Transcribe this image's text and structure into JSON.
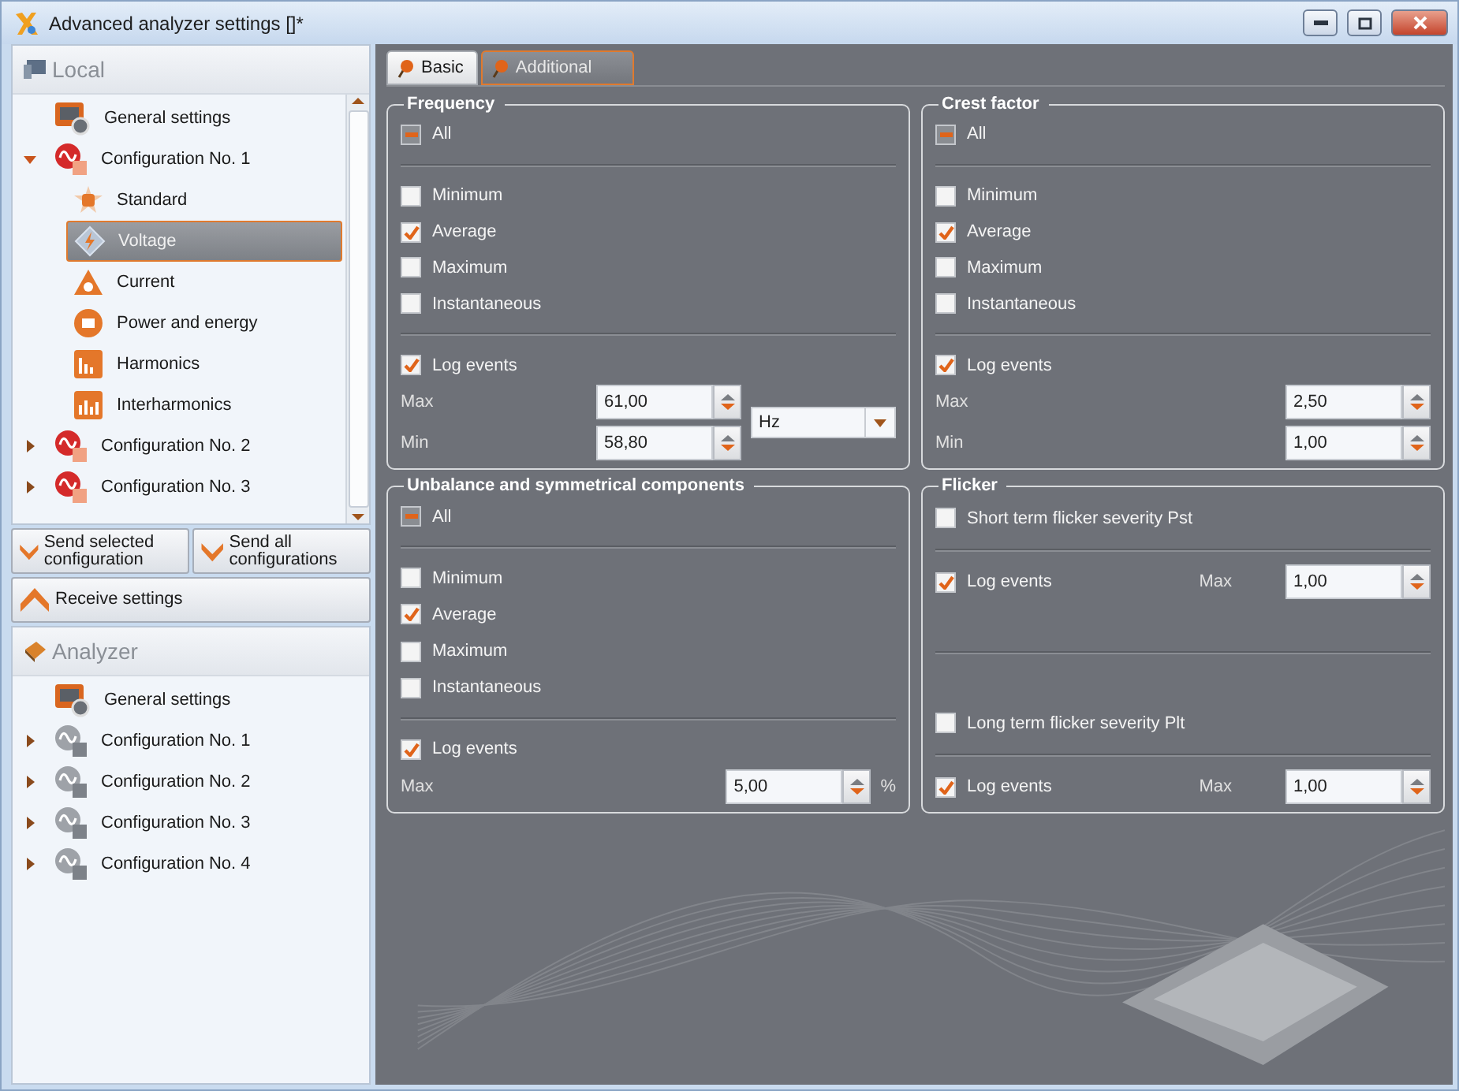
{
  "window": {
    "title": "Advanced analyzer settings []*"
  },
  "local": {
    "title": "Local",
    "items": [
      {
        "label": "General settings",
        "kind": "general",
        "selected": false
      },
      {
        "label": "Configuration No. 1",
        "kind": "config",
        "selected": false,
        "expanded": true,
        "children": [
          {
            "label": "Standard",
            "kind": "standard",
            "selected": false
          },
          {
            "label": "Voltage",
            "kind": "voltage",
            "selected": true
          },
          {
            "label": "Current",
            "kind": "current",
            "selected": false
          },
          {
            "label": "Power and energy",
            "kind": "power",
            "selected": false
          },
          {
            "label": "Harmonics",
            "kind": "harmonics",
            "selected": false
          },
          {
            "label": "Interharmonics",
            "kind": "interharmonics",
            "selected": false
          }
        ]
      },
      {
        "label": "Configuration No. 2",
        "kind": "config",
        "selected": false,
        "expanded": false
      },
      {
        "label": "Configuration No. 3",
        "kind": "config",
        "selected": false,
        "expanded": false
      }
    ]
  },
  "actions": [
    {
      "label": "Send selected configuration",
      "kind": "send"
    },
    {
      "label": "Send all configurations",
      "kind": "send"
    },
    {
      "label": "Receive settings",
      "kind": "receive"
    }
  ],
  "analyzer": {
    "title": "Analyzer",
    "items": [
      {
        "label": "General settings",
        "kind": "general",
        "selected": false
      },
      {
        "label": "Configuration No. 1",
        "kind": "device_config",
        "selected": false,
        "expanded": false
      },
      {
        "label": "Configuration No. 2",
        "kind": "device_config",
        "selected": false,
        "expanded": false
      },
      {
        "label": "Configuration No. 3",
        "kind": "device_config",
        "selected": false,
        "expanded": false
      },
      {
        "label": "Configuration No. 4",
        "kind": "device_config",
        "selected": false,
        "expanded": false
      }
    ]
  },
  "tabs": [
    {
      "label": "Basic",
      "selected": false
    },
    {
      "label": "Additional",
      "selected": true
    }
  ],
  "groups": [
    {
      "title": "Frequency",
      "items": [
        {
          "kind": "all",
          "label": "All",
          "indeterminate": true
        },
        {
          "kind": "divider"
        },
        {
          "kind": "check",
          "label": "Minimum",
          "checked": false
        },
        {
          "kind": "check",
          "label": "Average",
          "checked": true
        },
        {
          "kind": "check",
          "label": "Maximum",
          "checked": false
        },
        {
          "kind": "check",
          "label": "Instantaneous",
          "checked": false
        },
        {
          "kind": "divider"
        },
        {
          "kind": "check",
          "label": "Log events",
          "checked": true
        },
        {
          "kind": "limits",
          "fields": [
            {
              "label": "Max",
              "value": "61,00"
            },
            {
              "label": "Min",
              "value": "58,80"
            }
          ],
          "unit_select": "Hz"
        }
      ]
    },
    {
      "title": "Crest factor",
      "items": [
        {
          "kind": "all",
          "label": "All",
          "indeterminate": true
        },
        {
          "kind": "divider"
        },
        {
          "kind": "check",
          "label": "Minimum",
          "checked": false
        },
        {
          "kind": "check",
          "label": "Average",
          "checked": true
        },
        {
          "kind": "check",
          "label": "Maximum",
          "checked": false
        },
        {
          "kind": "check",
          "label": "Instantaneous",
          "checked": false
        },
        {
          "kind": "divider"
        },
        {
          "kind": "check",
          "label": "Log events",
          "checked": true
        },
        {
          "kind": "limits",
          "fields": [
            {
              "label": "Max",
              "value": "2,50"
            },
            {
              "label": "Min",
              "value": "1,00"
            }
          ]
        }
      ]
    },
    {
      "title": "Unbalance and symmetrical components",
      "items": [
        {
          "kind": "all",
          "label": "All",
          "indeterminate": true
        },
        {
          "kind": "divider"
        },
        {
          "kind": "check",
          "label": "Minimum",
          "checked": false
        },
        {
          "kind": "check",
          "label": "Average",
          "checked": true
        },
        {
          "kind": "check",
          "label": "Maximum",
          "checked": false
        },
        {
          "kind": "check",
          "label": "Instantaneous",
          "checked": false
        },
        {
          "kind": "divider"
        },
        {
          "kind": "check",
          "label": "Log events",
          "checked": true
        },
        {
          "kind": "limits",
          "fields": [
            {
              "label": "Max",
              "value": "5,00",
              "unit": "%"
            }
          ]
        }
      ]
    },
    {
      "title": "Flicker",
      "items": [
        {
          "kind": "check",
          "label": "Short term flicker severity Pst",
          "checked": false
        },
        {
          "kind": "divider"
        },
        {
          "kind": "check_max",
          "label": "Log events",
          "checked": true,
          "max_label": "Max",
          "value": "1,00"
        },
        {
          "kind": "divider"
        },
        {
          "kind": "check",
          "label": "Long term flicker severity Plt",
          "checked": false
        },
        {
          "kind": "divider"
        },
        {
          "kind": "check_max",
          "label": "Log events",
          "checked": true,
          "max_label": "Max",
          "value": "1,00"
        }
      ]
    }
  ]
}
